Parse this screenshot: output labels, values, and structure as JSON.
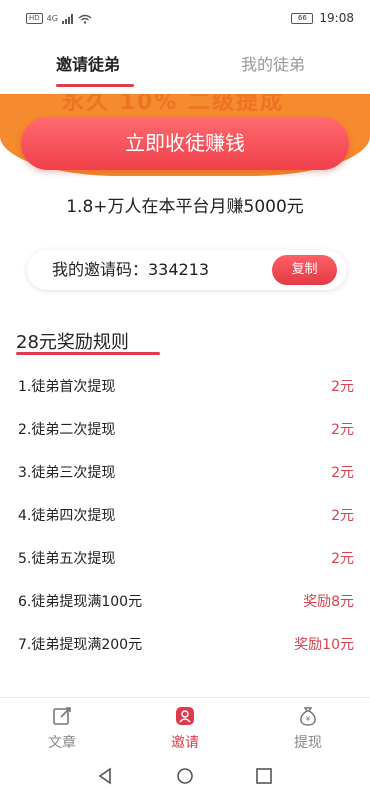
{
  "status_bar": {
    "left_chip": "HD",
    "signal": "4G",
    "battery": "66",
    "time": "19:08"
  },
  "tabs": [
    {
      "label": "邀请徒弟",
      "active": true
    },
    {
      "label": "我的徒弟",
      "active": false
    }
  ],
  "banner": {
    "partial_text": "永久 10% 二级提成"
  },
  "cta": {
    "label": "立即收徒赚钱"
  },
  "promo_line": "1.8+万人在本平台月赚5000元",
  "invite": {
    "label": "我的邀请码：334213",
    "copy_label": "复制"
  },
  "rules": {
    "title": "28元奖励规则",
    "items": [
      {
        "name": "1.徒弟首次提现",
        "reward": "2元"
      },
      {
        "name": "2.徒弟二次提现",
        "reward": "2元"
      },
      {
        "name": "3.徒弟三次提现",
        "reward": "2元"
      },
      {
        "name": "4.徒弟四次提现",
        "reward": "2元"
      },
      {
        "name": "5.徒弟五次提现",
        "reward": "2元"
      },
      {
        "name": "6.徒弟提现满100元",
        "reward": "奖励8元"
      },
      {
        "name": "7.徒弟提现满200元",
        "reward": "奖励10元"
      }
    ]
  },
  "bottom_nav": [
    {
      "label": "文章",
      "icon": "edit-icon",
      "active": false
    },
    {
      "label": "邀请",
      "icon": "invite-icon",
      "active": true
    },
    {
      "label": "提现",
      "icon": "money-bag-icon",
      "active": false
    }
  ],
  "colors": {
    "accent": "#e03a4e",
    "banner_orange": "#f58a2e",
    "reward_red": "#d9424f"
  }
}
